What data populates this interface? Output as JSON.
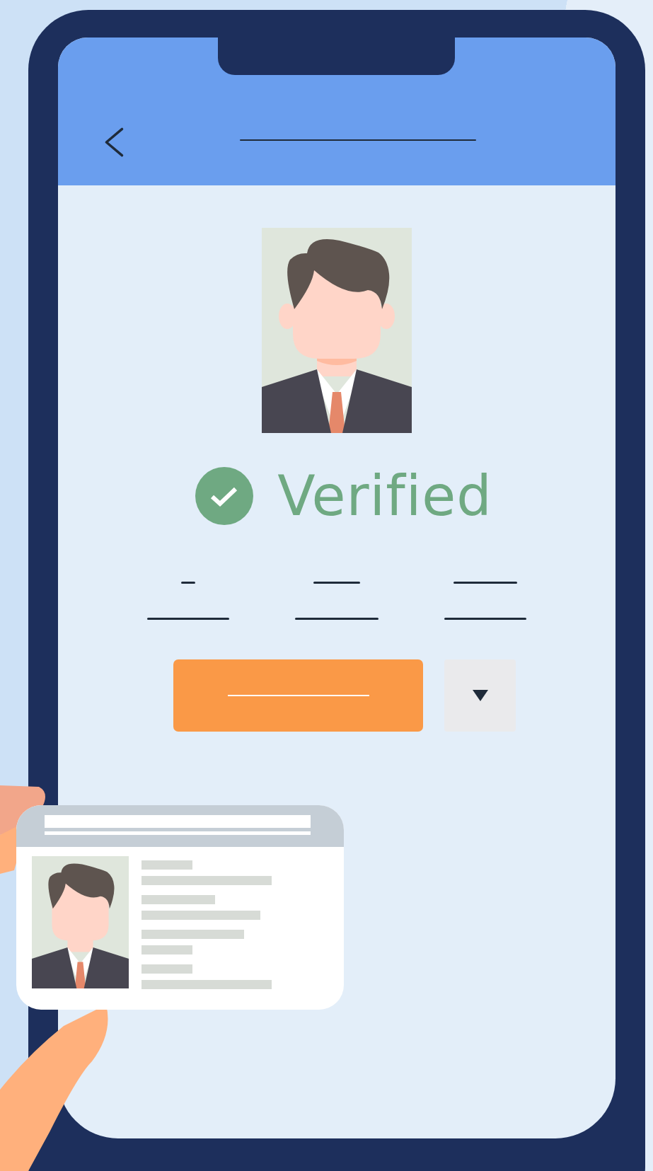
{
  "status": {
    "label": "Verified"
  }
}
